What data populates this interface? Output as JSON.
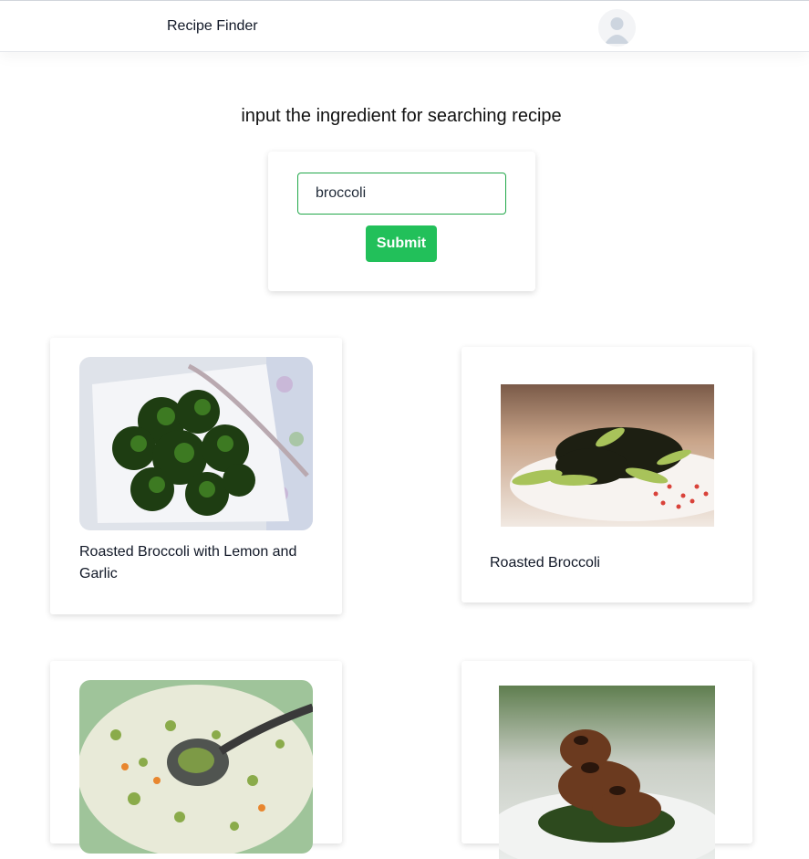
{
  "navbar": {
    "brand": "Recipe Finder",
    "avatar_icon": "user-avatar-icon"
  },
  "search": {
    "heading": "input the ingredient for searching recipe",
    "value": "broccoli",
    "placeholder": "",
    "submit_label": "Submit"
  },
  "recipes": [
    {
      "title": "Roasted Broccoli with Lemon and Garlic",
      "image": "broccoli-plate-photo"
    },
    {
      "title": "Roasted Broccoli",
      "image": "charred-broccoli-photo"
    },
    {
      "title": "",
      "image": "broccoli-soup-photo"
    },
    {
      "title": "",
      "image": "grilled-chicken-photo"
    }
  ],
  "colors": {
    "accent": "#22c05a",
    "input_border": "#22a84a",
    "text": "#111827"
  }
}
